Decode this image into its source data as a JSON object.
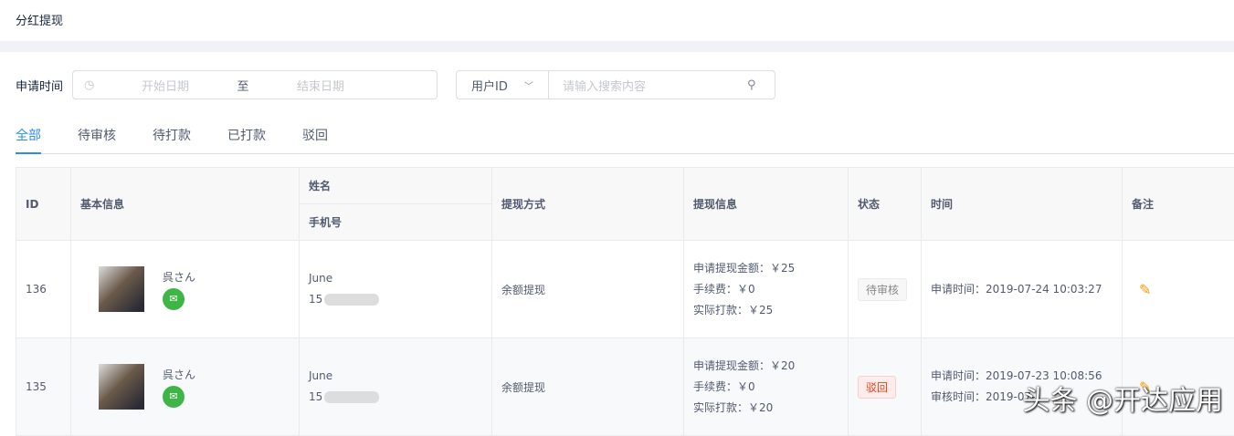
{
  "page_title": "分红提现",
  "filters": {
    "date_label": "申请时间",
    "start_placeholder": "开始日期",
    "to": "至",
    "end_placeholder": "结束日期",
    "field_select": "用户ID",
    "search_placeholder": "请输入搜索内容"
  },
  "tabs": [
    "全部",
    "待审核",
    "待打款",
    "已打款",
    "驳回"
  ],
  "columns": {
    "id": "ID",
    "basic": "基本信息",
    "name": "姓名",
    "phone": "手机号",
    "method": "提现方式",
    "info": "提现信息",
    "status": "状态",
    "time": "时间",
    "remark": "备注"
  },
  "rows": [
    {
      "id": "136",
      "nick": "呉さん",
      "name": "June",
      "phone": "15",
      "method": "余额提现",
      "apply_amount": "申请提现金额：￥25",
      "fee": "手续费：￥0",
      "actual": "实际打款：￥25",
      "status": "待审核",
      "apply_time": "申请时间：2019-07-24 10:03:27",
      "review_time": ""
    },
    {
      "id": "135",
      "nick": "呉さん",
      "name": "June",
      "phone": "15",
      "method": "余额提现",
      "apply_amount": "申请提现金额：￥20",
      "fee": "手续费：￥0",
      "actual": "实际打款：￥20",
      "status": "驳回",
      "apply_time": "申请时间：2019-07-23 10:08:56",
      "review_time": "审核时间：2019-07-..."
    }
  ],
  "watermark": "头条 @开达应用"
}
